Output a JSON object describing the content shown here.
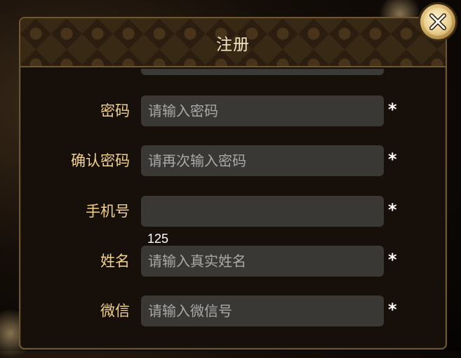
{
  "dialog": {
    "title": "注册",
    "fields": [
      {
        "label": "密码",
        "value": "",
        "placeholder": "请输入密码",
        "required": "*"
      },
      {
        "label": "确认密码",
        "value": "",
        "placeholder": "请再次输入密码",
        "required": "*"
      },
      {
        "label": "手机号",
        "value": "",
        "placeholder": "",
        "required": "*"
      },
      {
        "label": "姓名",
        "value": "",
        "placeholder": "请输入真实姓名",
        "required": "*"
      },
      {
        "label": "微信",
        "value": "",
        "placeholder": "请输入微信号",
        "required": "*"
      }
    ],
    "overlay_text": "125"
  },
  "icons": {
    "close": "close-icon"
  },
  "colors": {
    "label": "#f1d28a",
    "title": "#f3e6c6",
    "input_bg": "#3a3835",
    "border": "#6e5630"
  }
}
